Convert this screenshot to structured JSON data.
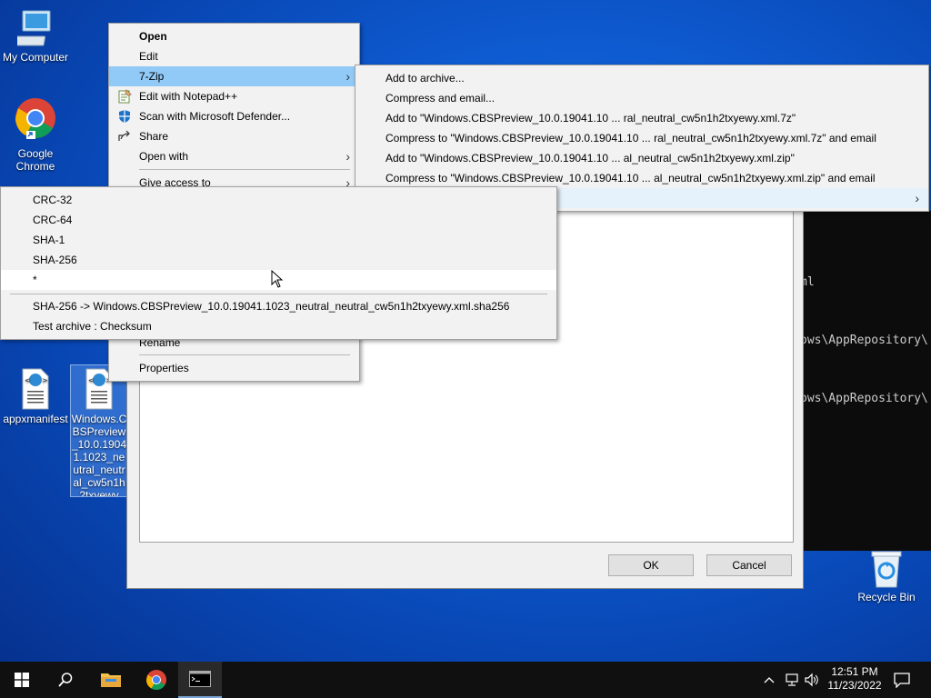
{
  "desktop": {
    "icons": {
      "my_computer": "My Computer",
      "chrome": "Google Chrome",
      "manifest": "appxmanifest",
      "selected_file": "Windows.CBSPreview_10.0.19041.1023_neutral_neutral_cw5n1h2txyewy",
      "recycle_bin": "Recycle Bin"
    }
  },
  "terminal": {
    "lines": [
      "ml",
      "ows\\AppRepository\\",
      "ows\\AppRepository\\"
    ]
  },
  "dialog": {
    "ok_label": "OK",
    "cancel_label": "Cancel"
  },
  "context_menu": {
    "items": [
      {
        "label": "Open"
      },
      {
        "label": "Edit"
      },
      {
        "label": "7-Zip"
      },
      {
        "label": "Edit with Notepad++"
      },
      {
        "label": "Scan with Microsoft Defender..."
      },
      {
        "label": "Share"
      },
      {
        "label": "Open with"
      },
      {
        "label": "Give access to"
      },
      {
        "label": "Rename"
      },
      {
        "label": "Properties"
      }
    ]
  },
  "zip_menu": {
    "items": [
      {
        "label": "Add to archive..."
      },
      {
        "label": "Compress and email..."
      },
      {
        "label": "Add to \"Windows.CBSPreview_10.0.19041.10 ... ral_neutral_cw5n1h2txyewy.xml.7z\""
      },
      {
        "label": "Compress to \"Windows.CBSPreview_10.0.19041.10 ... ral_neutral_cw5n1h2txyewy.xml.7z\" and email"
      },
      {
        "label": "Add to \"Windows.CBSPreview_10.0.19041.10 ... al_neutral_cw5n1h2txyewy.xml.zip\""
      },
      {
        "label": "Compress to \"Windows.CBSPreview_10.0.19041.10 ... al_neutral_cw5n1h2txyewy.xml.zip\" and email"
      }
    ]
  },
  "crc_menu": {
    "items": [
      {
        "label": "CRC-32"
      },
      {
        "label": "CRC-64"
      },
      {
        "label": "SHA-1"
      },
      {
        "label": "SHA-256"
      },
      {
        "label": "*"
      },
      {
        "label": "SHA-256 -> Windows.CBSPreview_10.0.19041.1023_neutral_neutral_cw5n1h2txyewy.xml.sha256"
      },
      {
        "label": "Test archive : Checksum"
      }
    ]
  },
  "taskbar": {
    "time": "12:51 PM",
    "date": "11/23/2022"
  },
  "colors": {
    "menu_highlight": "#91c9f7",
    "taskbar": "#101010"
  }
}
